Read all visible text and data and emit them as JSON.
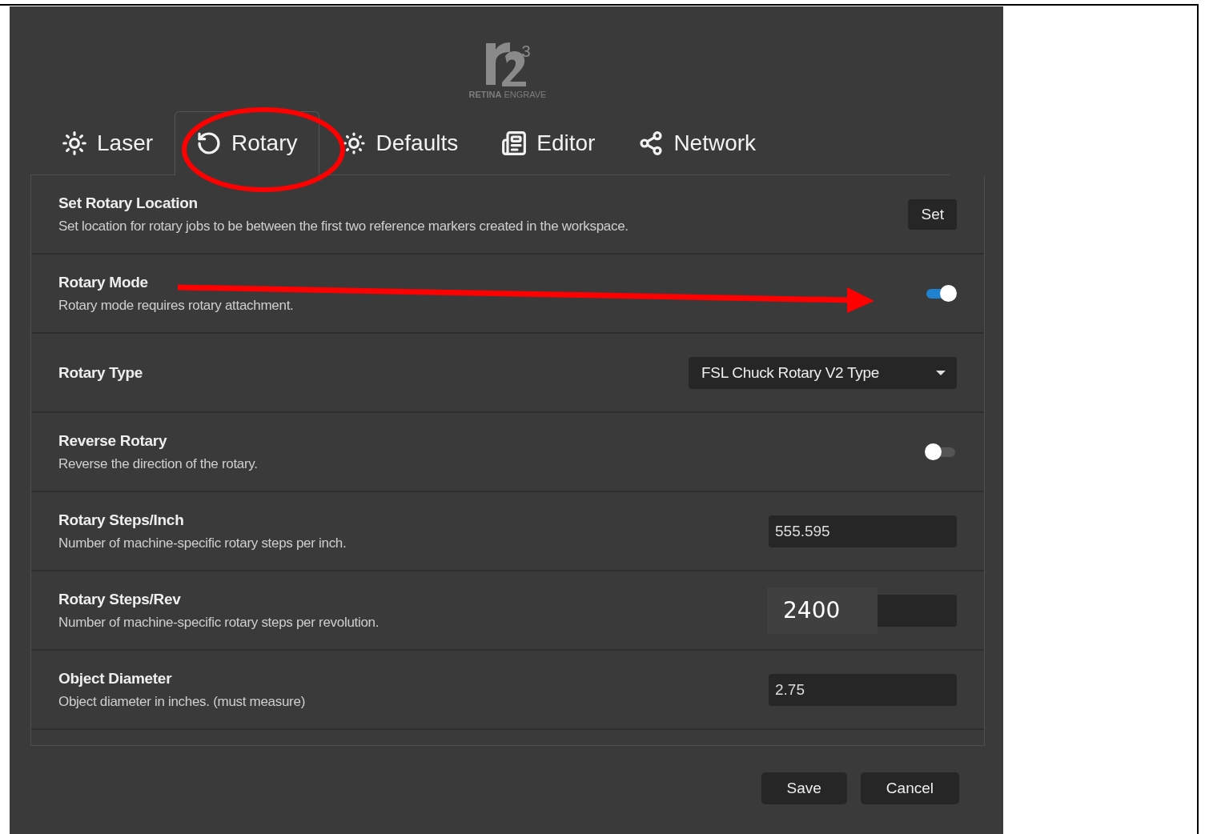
{
  "logo": {
    "superscript": "3",
    "brand_bold": "RETINA",
    "brand_light": "ENGRAVE"
  },
  "tabs": [
    {
      "label": "Laser",
      "selected": false
    },
    {
      "label": "Rotary",
      "selected": true
    },
    {
      "label": "Defaults",
      "selected": false
    },
    {
      "label": "Editor",
      "selected": false
    },
    {
      "label": "Network",
      "selected": false
    }
  ],
  "settings": [
    {
      "kind": "button",
      "title": "Set Rotary Location",
      "description": "Set location for rotary jobs to be between the first two reference markers created in the workspace.",
      "button": "Set"
    },
    {
      "kind": "toggle",
      "title": "Rotary Mode",
      "description": "Rotary mode requires rotary attachment.",
      "on": true
    },
    {
      "kind": "select",
      "title": "Rotary Type",
      "value": "FSL Chuck Rotary V2 Type"
    },
    {
      "kind": "toggle",
      "title": "Reverse Rotary",
      "description": "Reverse the direction of the rotary.",
      "on": false
    },
    {
      "kind": "input",
      "title": "Rotary Steps/Inch",
      "description": "Number of machine-specific rotary steps per inch.",
      "value": "555.595"
    },
    {
      "kind": "patched",
      "title": "Rotary Steps/Rev",
      "description": "Number of machine-specific rotary steps per revolution.",
      "value": "2400"
    },
    {
      "kind": "input",
      "title": "Object Diameter",
      "description": "Object diameter in inches. (must measure)",
      "value": "2.75"
    }
  ],
  "buttons": [
    "Save",
    "Cancel"
  ]
}
